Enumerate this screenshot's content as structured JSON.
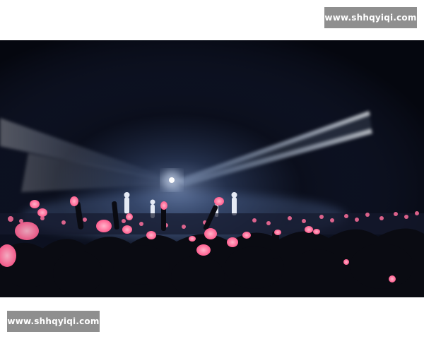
{
  "watermarks": {
    "top_text": "www.shhqyiqi.com",
    "bottom_text": "www.shhqyiqi.com"
  },
  "photo": {
    "subject": "concert stage with spotlight beams and audience holding pink heart lightsticks",
    "colors": {
      "background": "#05070f",
      "beam": "#cfe3ff",
      "lightstick": "#ff7fa8",
      "crowd": "#0b0c14"
    }
  }
}
